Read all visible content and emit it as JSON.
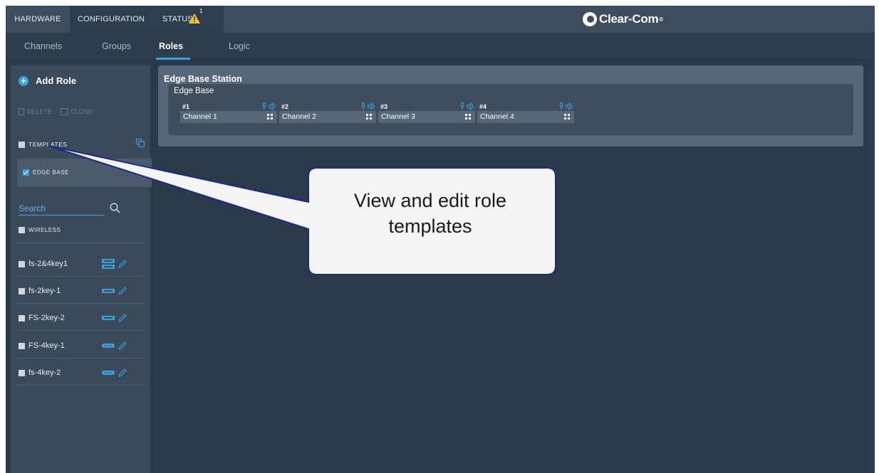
{
  "top_tabs": [
    {
      "label": "HARDWARE"
    },
    {
      "label": "CONFIGURATION"
    },
    {
      "label": "STATUS",
      "warning_count": "1"
    }
  ],
  "brand": {
    "name": "Clear-Com",
    "mark": "®"
  },
  "sub_tabs": [
    {
      "label": "Channels"
    },
    {
      "label": "Groups"
    },
    {
      "label": "Roles"
    },
    {
      "label": "Logic"
    }
  ],
  "sidebar": {
    "add_role": "Add Role",
    "delete": "DELETE",
    "clone": "CLONE",
    "templates": "TEMPLATES",
    "edge_base": "EDGE BASE",
    "search_placeholder": "Search",
    "wireless": "WIRELESS",
    "devices": [
      {
        "name": "fs-2&4key1"
      },
      {
        "name": "fs-2key-1"
      },
      {
        "name": "FS-2key-2"
      },
      {
        "name": "FS-4key-1"
      },
      {
        "name": "fs-4key-2"
      }
    ]
  },
  "main": {
    "station_title": "Edge Base Station",
    "device_title": "Edge Base",
    "slots": [
      {
        "number": "#1",
        "channel": "Channel 1"
      },
      {
        "number": "#2",
        "channel": "Channel 2"
      },
      {
        "number": "#3",
        "channel": "Channel 3"
      },
      {
        "number": "#4",
        "channel": "Channel 4"
      }
    ]
  },
  "callout": {
    "line1": "View and edit role",
    "line2": "templates"
  },
  "colors": {
    "accent": "#3aa0e0",
    "warning": "#f2c12e",
    "background": "#2b3a4a"
  }
}
